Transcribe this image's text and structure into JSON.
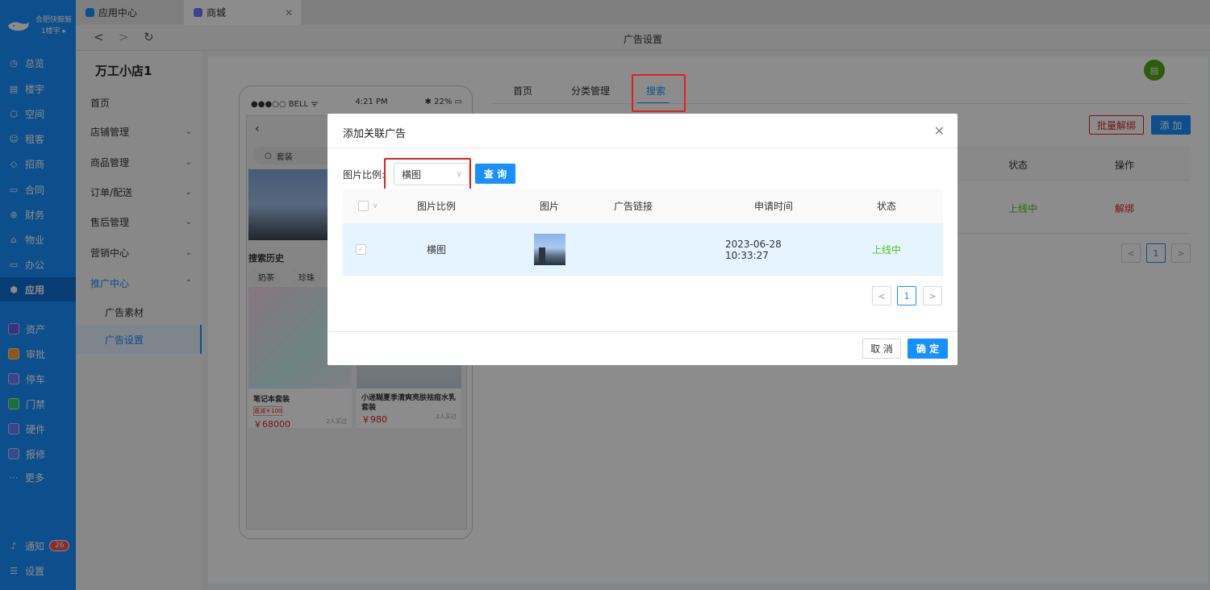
{
  "brand": {
    "name": "合肥快鲸鲸",
    "building": "1楼宇"
  },
  "leftnav": {
    "items": [
      {
        "icon": "clock-icon",
        "label": "总览"
      },
      {
        "icon": "building-icon",
        "label": "楼宇"
      },
      {
        "icon": "cube-icon",
        "label": "空间"
      },
      {
        "icon": "people-icon",
        "label": "租客"
      },
      {
        "icon": "tag-icon",
        "label": "招商"
      },
      {
        "icon": "doc-icon",
        "label": "合同"
      },
      {
        "icon": "money-icon",
        "label": "财务"
      },
      {
        "icon": "home-icon",
        "label": "物业"
      },
      {
        "icon": "monitor-icon",
        "label": "办公"
      },
      {
        "icon": "app-icon",
        "label": "应用"
      }
    ],
    "apps": [
      {
        "label": "资产",
        "color": "#6c5ce7"
      },
      {
        "label": "审批",
        "color": "#ff9f2d"
      },
      {
        "label": "停车",
        "color": "#6a7bff"
      },
      {
        "label": "门禁",
        "color": "#2ecc71"
      },
      {
        "label": "硬件",
        "color": "#6a7bff"
      },
      {
        "label": "报修",
        "color": "#5b8cff"
      }
    ],
    "more": "更多",
    "notify": "通知",
    "notify_count": "26",
    "settings": "设置"
  },
  "tabs": [
    {
      "label": "应用中心"
    },
    {
      "label": "商城"
    }
  ],
  "page_title": "广告设置",
  "sidebar": {
    "shop_name": "万工小店1",
    "items": [
      "首页",
      "店铺管理",
      "商品管理",
      "订单/配送",
      "售后管理",
      "营销中心",
      "推广中心",
      "广告素材",
      "广告设置"
    ]
  },
  "phone": {
    "carrier": "●●●○○ BELL ᯤ",
    "time": "4:21 PM",
    "battery": "22%",
    "search_text": "套装",
    "history_title": "搜索历史",
    "history_tags": [
      "奶茶",
      "珍珠"
    ],
    "products": [
      {
        "name": "笔记本套装",
        "tag": "直减￥100",
        "price": "￥68000",
        "sold": "2人买过"
      },
      {
        "name": "小迷糊夏季清爽亮肤祛痘水乳套装",
        "price": "￥980",
        "sold": "2人买过"
      }
    ]
  },
  "content_tabs": [
    "首页",
    "分类管理",
    "搜索"
  ],
  "bg_actions": {
    "batch_unbind": "批量解绑",
    "add": "添 加"
  },
  "bg_table": {
    "headers": [
      "状态",
      "操作"
    ],
    "status": "上线中",
    "action": "解绑",
    "page": "1"
  },
  "dialog": {
    "title": "添加关联广告",
    "ratio_label": "图片比例:",
    "ratio_value": "横图",
    "query": "查 询",
    "columns": [
      "图片比例",
      "图片",
      "广告链接",
      "申请时间",
      "状态"
    ],
    "rows": [
      {
        "ratio": "横图",
        "link": "",
        "time": "2023-06-28 10:33:27",
        "status": "上线中"
      }
    ],
    "page": "1",
    "cancel": "取 消",
    "ok": "确 定"
  },
  "colors": {
    "primary": "#1890ff",
    "online": "#52c41a",
    "danger": "#e02020"
  }
}
